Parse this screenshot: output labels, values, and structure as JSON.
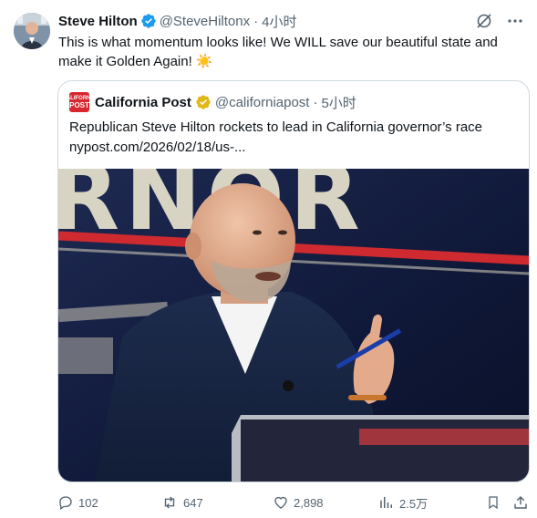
{
  "tweet": {
    "author_name": "Steve Hilton",
    "author_handle": "@SteveHiltonx",
    "separator": "·",
    "time": "4小时",
    "text": "This is what momentum looks like! We WILL save our beautiful state and make it Golden Again! ☀️"
  },
  "quote": {
    "logo_lines": [
      "CALIFORNIA",
      "POST"
    ],
    "author_name": "California Post",
    "author_handle": "@californiapost",
    "separator": "·",
    "time": "5小时",
    "headline": "Republican Steve Hilton rockets to lead in California governor’s race",
    "link": "nypost.com/2026/02/18/us-...",
    "image_backdrop_text": "RNOR"
  },
  "actions": {
    "replies": "102",
    "reposts": "647",
    "likes": "2,898",
    "views": "2.5万"
  },
  "icons": {
    "verified": "verified-badge-icon",
    "gold_verified": "gold-verified-badge-icon",
    "grok": "grok-icon",
    "more": "more-icon",
    "reply": "reply-icon",
    "repost": "repost-icon",
    "like": "heart-icon",
    "views": "views-icon",
    "bookmark": "bookmark-icon",
    "share": "share-icon"
  },
  "colors": {
    "verified_blue": "#1d9bf0",
    "gold": "#e2b719",
    "muted_text": "#536471",
    "logo_red": "#d8262e"
  }
}
